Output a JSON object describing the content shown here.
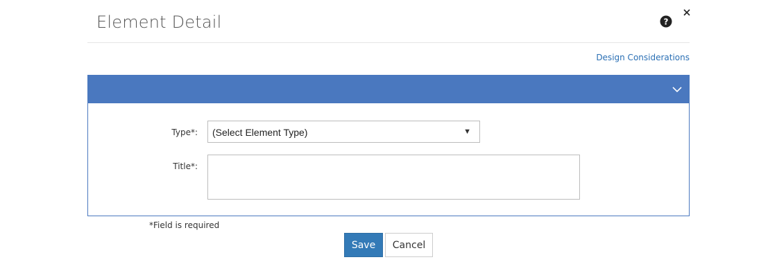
{
  "dialog": {
    "title": "Element Detail",
    "help_icon": "question-circle-icon",
    "close_icon": "close-icon",
    "close_symbol": "×"
  },
  "links": {
    "design_considerations": "Design Considerations"
  },
  "panel": {
    "header_color": "#4a78bf",
    "collapse_icon": "chevron-down-icon"
  },
  "form": {
    "type_label": "Type*:",
    "type_value": "(Select Element Type)",
    "title_label": "Title*:",
    "title_value": ""
  },
  "footer": {
    "required_note": "*Field is required",
    "save_label": "Save",
    "cancel_label": "Cancel"
  },
  "colors": {
    "primary_button": "#337ab7",
    "link": "#2a6fb4"
  }
}
